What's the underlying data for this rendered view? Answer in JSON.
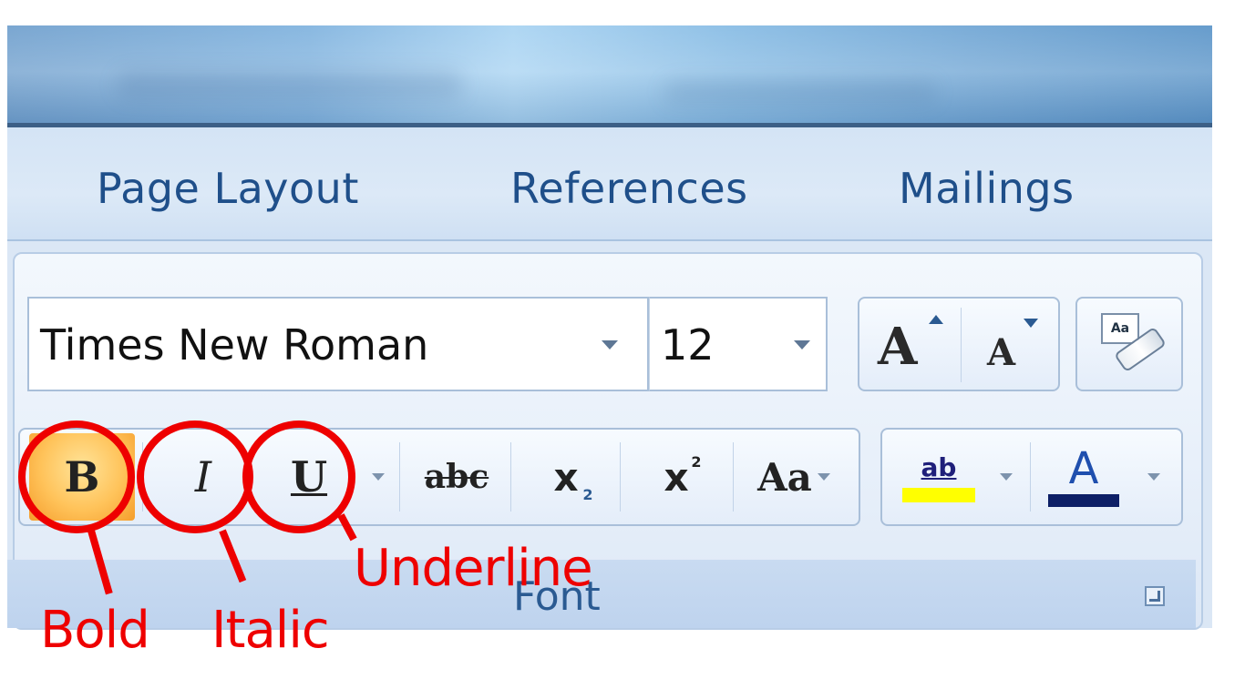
{
  "ribbon_tabs": [
    "Page Layout",
    "References",
    "Mailings"
  ],
  "font_group": {
    "label": "Font",
    "font_name": "Times New Roman",
    "font_size": "12",
    "grow_glyph": "A",
    "shrink_glyph": "A",
    "clear_glyph": "Aa"
  },
  "format_buttons": {
    "bold": "B",
    "italic": "I",
    "underline": "U",
    "strikethrough": "abc",
    "subscript": "x",
    "subscript_mark": "2",
    "superscript": "x",
    "superscript_mark": "2",
    "change_case": "Aa",
    "highlight": "ab",
    "font_color": "A"
  },
  "colors": {
    "highlight": "#ffff00",
    "font_color_bar": "#0d1f66",
    "bold_active": "#ffc35a",
    "annotation": "#ee0000",
    "tab_text": "#1f4f8a"
  },
  "annotations": [
    "Bold",
    "Italic",
    "Underline"
  ]
}
